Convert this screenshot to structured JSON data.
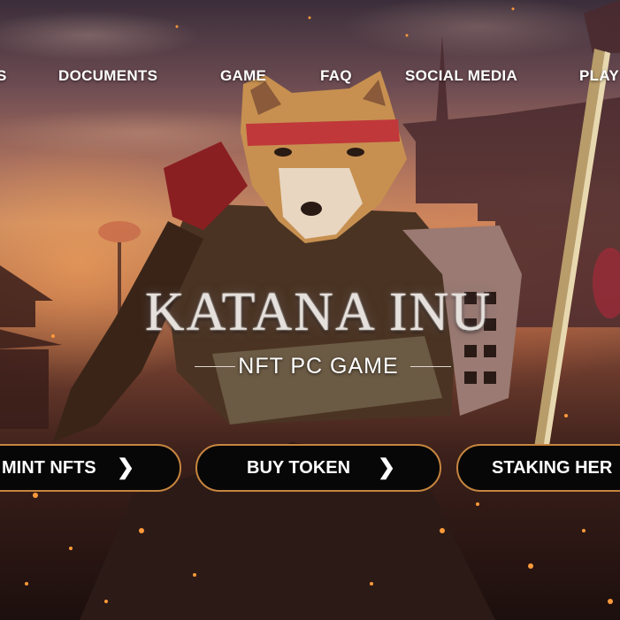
{
  "nav": {
    "items": [
      {
        "label": "S"
      },
      {
        "label": "DOCUMENTS"
      },
      {
        "label": "GAME"
      },
      {
        "label": "FAQ"
      },
      {
        "label": "SOCIAL MEDIA"
      },
      {
        "label": "PLAY"
      }
    ]
  },
  "hero": {
    "title": "KATANA INU",
    "subtitle": "NFT PC GAME"
  },
  "cta": {
    "mint": {
      "label": "MINT NFTS",
      "icon": "chevron-right-icon"
    },
    "buy": {
      "label": "BUY TOKEN",
      "icon": "chevron-right-icon"
    },
    "staking": {
      "label": "STAKING HER"
    }
  },
  "colors": {
    "button_bg": "#070707",
    "button_border": "#c6853f",
    "text": "#ffffff"
  }
}
